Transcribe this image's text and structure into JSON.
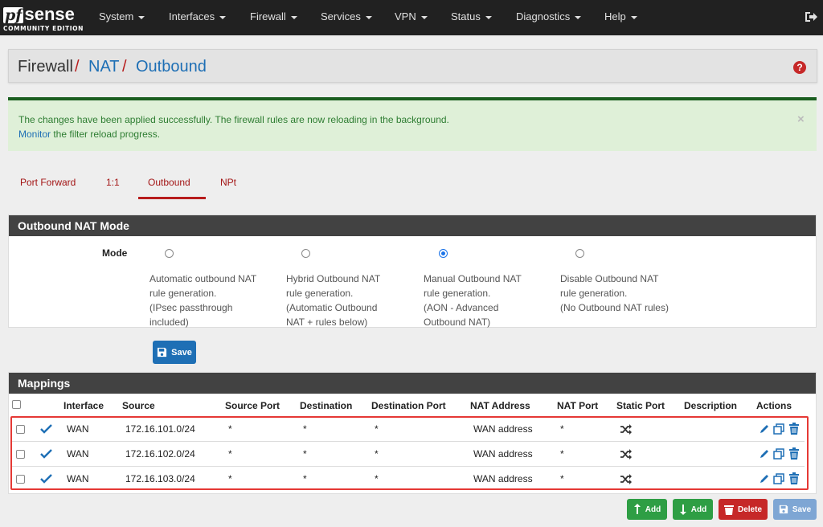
{
  "navbar": {
    "logo_pf": "pf",
    "logo_sense": "sense",
    "logo_edition": "COMMUNITY EDITION",
    "menu": [
      "System",
      "Interfaces",
      "Firewall",
      "Services",
      "VPN",
      "Status",
      "Diagnostics",
      "Help"
    ],
    "logout_icon": "sign-out-icon"
  },
  "breadcrumb": {
    "items": [
      "Firewall",
      "NAT",
      "Outbound"
    ],
    "separator": "/",
    "help_icon": "question-circle-icon",
    "help_glyph": "?"
  },
  "alert": {
    "line1": "The changes have been applied successfully. The firewall rules are now reloading in the background.",
    "link": "Monitor",
    "line2_rest": " the filter reload progress.",
    "close": "×"
  },
  "tabs": {
    "items": [
      "Port Forward",
      "1:1",
      "Outbound",
      "NPt"
    ],
    "active": "Outbound"
  },
  "outbound_mode": {
    "title": "Outbound NAT Mode",
    "label": "Mode",
    "options": [
      {
        "lines": [
          "Automatic outbound NAT",
          "rule generation.",
          "(IPsec passthrough",
          "included)"
        ],
        "checked": false
      },
      {
        "lines": [
          "Hybrid Outbound NAT",
          "rule generation.",
          "(Automatic Outbound",
          "NAT + rules below)"
        ],
        "checked": false
      },
      {
        "lines": [
          "Manual Outbound NAT",
          "rule generation.",
          "(AON - Advanced",
          "Outbound NAT)"
        ],
        "checked": true
      },
      {
        "lines": [
          "Disable Outbound NAT",
          "rule generation.",
          "(No Outbound NAT rules)"
        ],
        "checked": false
      }
    ],
    "save_label": "Save"
  },
  "mappings": {
    "title": "Mappings",
    "columns": [
      "Interface",
      "Source",
      "Source Port",
      "Destination",
      "Destination Port",
      "NAT Address",
      "NAT Port",
      "Static Port",
      "Description",
      "Actions"
    ],
    "rows": [
      {
        "interface": "WAN",
        "source": "172.16.101.0/24",
        "source_port": "*",
        "destination": "*",
        "destination_port": "*",
        "nat_address": "WAN address",
        "nat_port": "*",
        "static_port": "shuffle-icon",
        "description": ""
      },
      {
        "interface": "WAN",
        "source": "172.16.102.0/24",
        "source_port": "*",
        "destination": "*",
        "destination_port": "*",
        "nat_address": "WAN address",
        "nat_port": "*",
        "static_port": "shuffle-icon",
        "description": ""
      },
      {
        "interface": "WAN",
        "source": "172.16.103.0/24",
        "source_port": "*",
        "destination": "*",
        "destination_port": "*",
        "nat_address": "WAN address",
        "nat_port": "*",
        "static_port": "shuffle-icon",
        "description": ""
      }
    ]
  },
  "actions": {
    "add_top_label": "Add",
    "add_bottom_label": "Add",
    "delete_label": "Delete",
    "save_label": "Save"
  },
  "colors": {
    "navbar_bg": "#212121",
    "link_blue": "#1e6fb5",
    "accent_red": "#b71c1c",
    "success_green": "#2e9e44",
    "panel_heading": "#424242"
  }
}
